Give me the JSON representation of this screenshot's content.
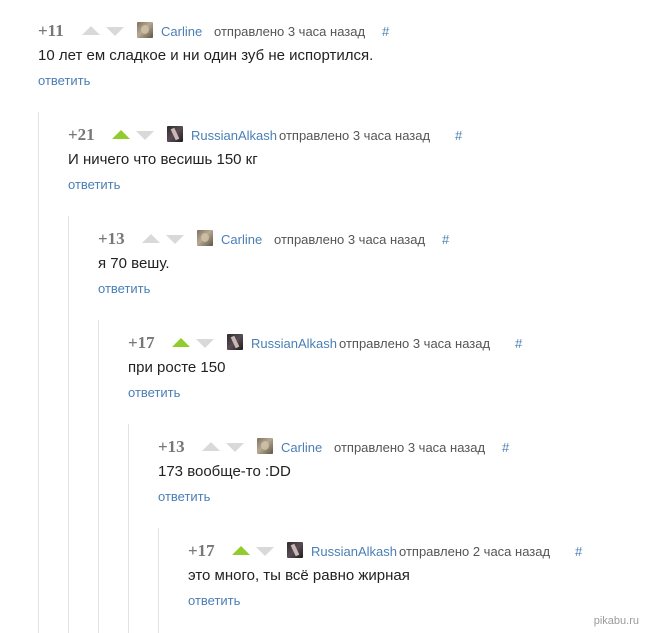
{
  "comments": [
    {
      "rating": "+11",
      "upvoted": false,
      "author": "Carline",
      "time": "отправлено 3 часа назад",
      "hash": "#",
      "text": "10 лет ем сладкое и ни один зуб не испортился.",
      "reply": "ответить",
      "avatar": "carline"
    },
    {
      "rating": "+21",
      "upvoted": true,
      "author": "RussianAlkash",
      "time": "отправлено 3 часа назад",
      "hash": "#",
      "text": "И ничего что весишь 150 кг",
      "reply": "ответить",
      "avatar": "alkash"
    },
    {
      "rating": "+13",
      "upvoted": false,
      "author": "Carline",
      "time": "отправлено 3 часа назад",
      "hash": "#",
      "text": "я 70 вешу.",
      "reply": "ответить",
      "avatar": "carline"
    },
    {
      "rating": "+17",
      "upvoted": true,
      "author": "RussianAlkash",
      "time": "отправлено 3 часа назад",
      "hash": "#",
      "text": "при росте 150",
      "reply": "ответить",
      "avatar": "alkash"
    },
    {
      "rating": "+13",
      "upvoted": false,
      "author": "Carline",
      "time": "отправлено 3 часа назад",
      "hash": "#",
      "text": "173 вообще-то :DD",
      "reply": "ответить",
      "avatar": "carline"
    },
    {
      "rating": "+17",
      "upvoted": true,
      "author": "RussianAlkash",
      "time": "отправлено 2 часа назад",
      "hash": "#",
      "text": "это много, ты всё равно жирная",
      "reply": "ответить",
      "avatar": "alkash"
    }
  ],
  "watermark": "pikabu.ru",
  "colors": {
    "link": "#4a7fb5",
    "upvote_active": "#8fcc2c",
    "vote_inactive": "#d9d9d9",
    "rating": "#777777",
    "thread_line": "#e3e3e3"
  }
}
